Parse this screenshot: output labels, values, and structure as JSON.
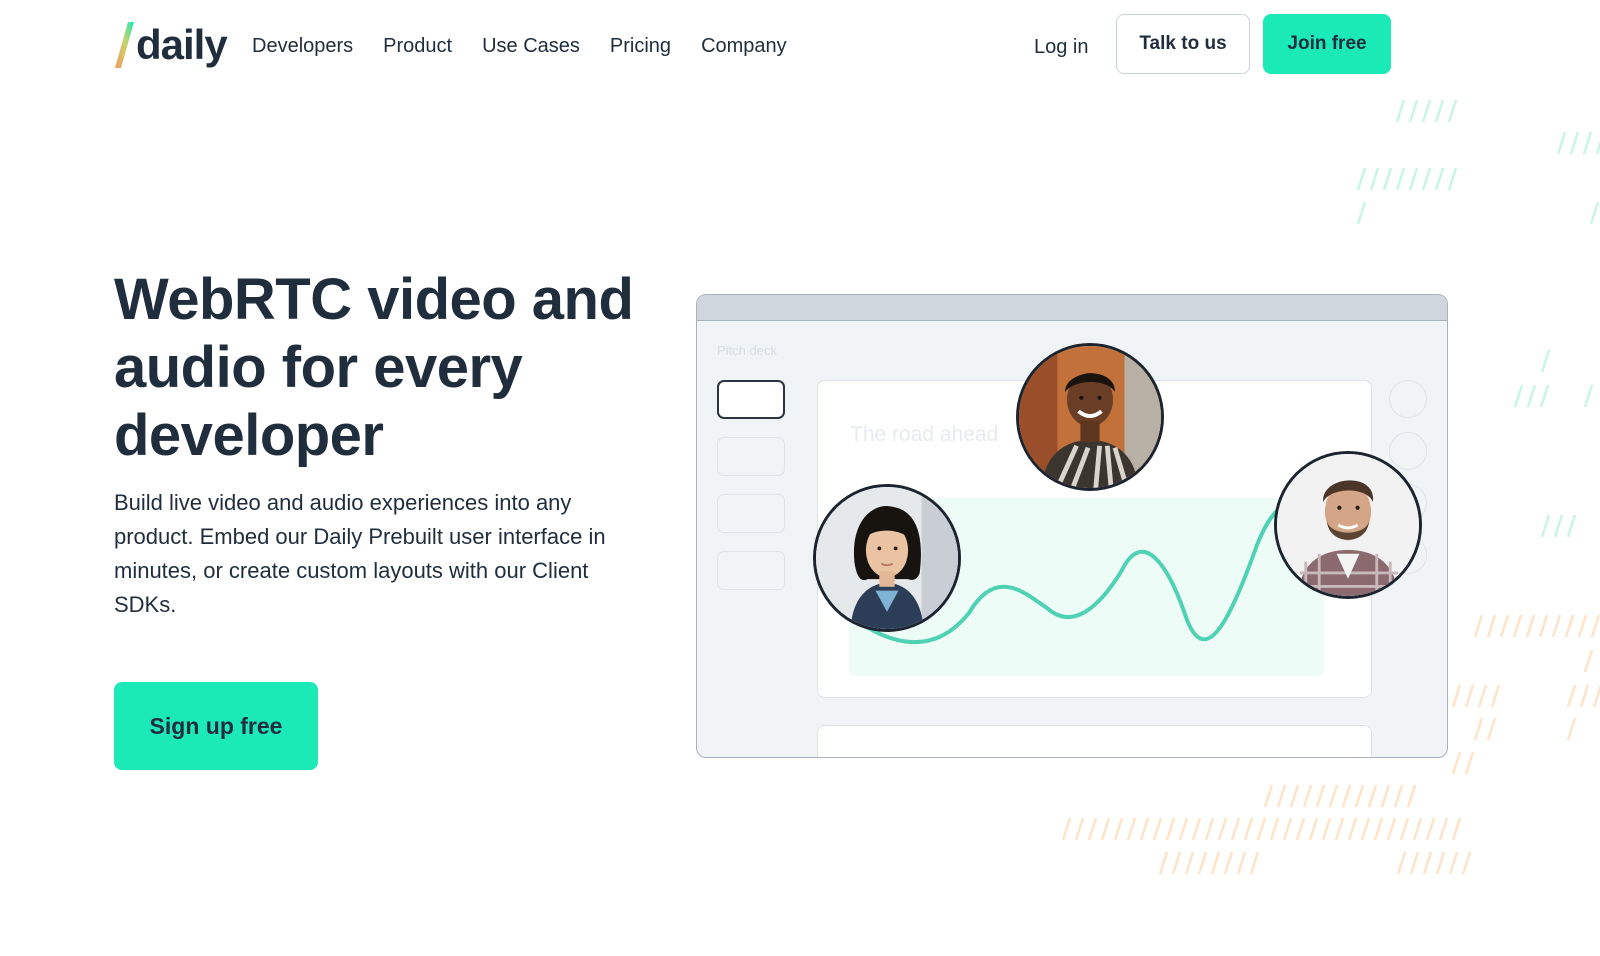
{
  "brand": {
    "name": "daily",
    "accent": "#1be9b6",
    "text_color": "#1f2d3d"
  },
  "nav": {
    "items": [
      {
        "label": "Developers"
      },
      {
        "label": "Product"
      },
      {
        "label": "Use Cases"
      },
      {
        "label": "Pricing"
      },
      {
        "label": "Company"
      }
    ],
    "login_label": "Log in",
    "talk_label": "Talk to us",
    "join_label": "Join free"
  },
  "hero": {
    "title": "WebRTC video and audio for every developer",
    "subtitle": "Build live video and audio experiences into any product. Embed our Daily Prebuilt user interface in minutes, or create custom layouts with our Client SDKs.",
    "cta_label": "Sign up free"
  },
  "illustration": {
    "deck_label": "Pitch deck",
    "slide_title": "The road ahead",
    "participants": [
      {
        "name": "participant-woman-left"
      },
      {
        "name": "participant-woman-top"
      },
      {
        "name": "participant-man-right"
      }
    ]
  }
}
